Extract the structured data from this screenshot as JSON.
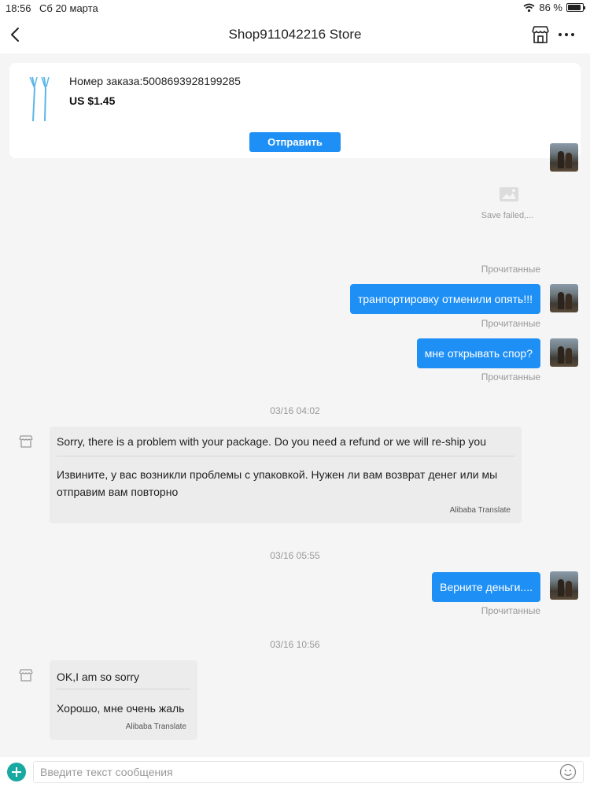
{
  "statusbar": {
    "time": "18:56",
    "date": "Сб 20 марта",
    "battery": "86 %"
  },
  "header": {
    "title": "Shop911042216 Store",
    "back_icon": "chevron-left-icon",
    "store_icon": "storefront-icon",
    "more_icon": "more-horizontal-icon"
  },
  "order": {
    "number_label": "Номер заказа:5008693928199285",
    "price": "US $1.45",
    "send_label": "Отправить"
  },
  "messages": {
    "save_failed": "Save failed,...",
    "read_label_1": "Прочитанные",
    "m1": {
      "text": "транпортировку отменили опять!!!",
      "status": "Прочитанные"
    },
    "m2": {
      "text": "мне открывать спор?",
      "status": "Прочитанные"
    },
    "ts1": "03/16 04:02",
    "m3": {
      "original": "Sorry, there is a problem with your package. Do you need a refund or we will re-ship you",
      "translated_line1": "Извините, у вас возникли проблемы с упаковкой. Нужен ли вам возврат денег или мы",
      "translated_line2": "отправим вам повторно",
      "translator": "Alibaba Translate"
    },
    "ts2": "03/16 05:55",
    "m4": {
      "text": "Верните деньги....",
      "status": "Прочитанные"
    },
    "ts3": "03/16 10:56",
    "m5": {
      "original": "OK,I am so sorry",
      "translated": "Хорошо, мне очень жаль",
      "translator": "Alibaba Translate"
    }
  },
  "input": {
    "placeholder": "Введите текст сообщения"
  },
  "colors": {
    "accent": "#1e8ff5",
    "plus": "#18a9a0",
    "incoming_bubble": "#ececec"
  }
}
